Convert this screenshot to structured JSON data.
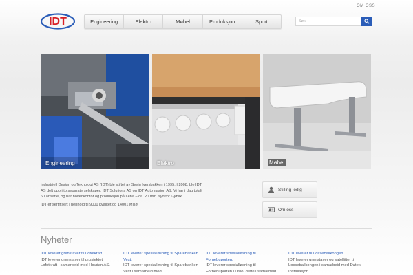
{
  "header": {
    "about_link": "OM OSS",
    "logo_text": "IDT",
    "search_placeholder": "Søk"
  },
  "nav": [
    "Engineering",
    "Elektro",
    "Møbel",
    "Produksjon",
    "Sport"
  ],
  "tiles": [
    {
      "label": "Engineering"
    },
    {
      "label": "Elektro"
    },
    {
      "label": "Møbel"
    }
  ],
  "intro": {
    "paragraph1": "Industriell Design og Teknologi AS (IDT) ble stiftet av Svein Iversbakken i 1995. I 2008, ble IDT AS delt opp i to separate selskaper: IDT Solutions AS og IDT Automasjon AS. Vi har i dag totalt 60 ansatte, og har hovedkontor og produksjon på Lena – ca. 20 min. syd for Gjøvik.",
    "paragraph2": "IDT er sertifisert i henhold til 9001 kvalitet og 14001 Miljø."
  },
  "side_buttons": [
    {
      "label": "Stilling ledig",
      "icon": "person-icon"
    },
    {
      "label": "Om oss",
      "icon": "id-card-icon"
    }
  ],
  "news": {
    "title": "Nyheter",
    "items": [
      {
        "headline": "IDT leverer grenstaver til Lofotkraft.",
        "text": "IDT leverer grenstaver til prosjektet Lofotkraft i samarbeid med Hovdan AS."
      },
      {
        "headline": "IDT leverer spesialløsning til Sparebanken Vest.",
        "text": "IDT leverer spesialløsning til Sparebanken Vest i samarbeid med"
      },
      {
        "headline": "IDT leverer spesialløsning til Fornebuporten.",
        "text": "IDT leverer spesialløsning til Fornebuporten i Oslo, dette i samarbeid med"
      },
      {
        "headline": "IDT leverer til Losseballkongen.",
        "text": "IDT leverer grenstaver og satellitter til Losseballkongen i samarbeid med Datek Installasjon."
      }
    ]
  },
  "colors": {
    "brand_red": "#d81f26",
    "brand_blue": "#2b5db8"
  }
}
